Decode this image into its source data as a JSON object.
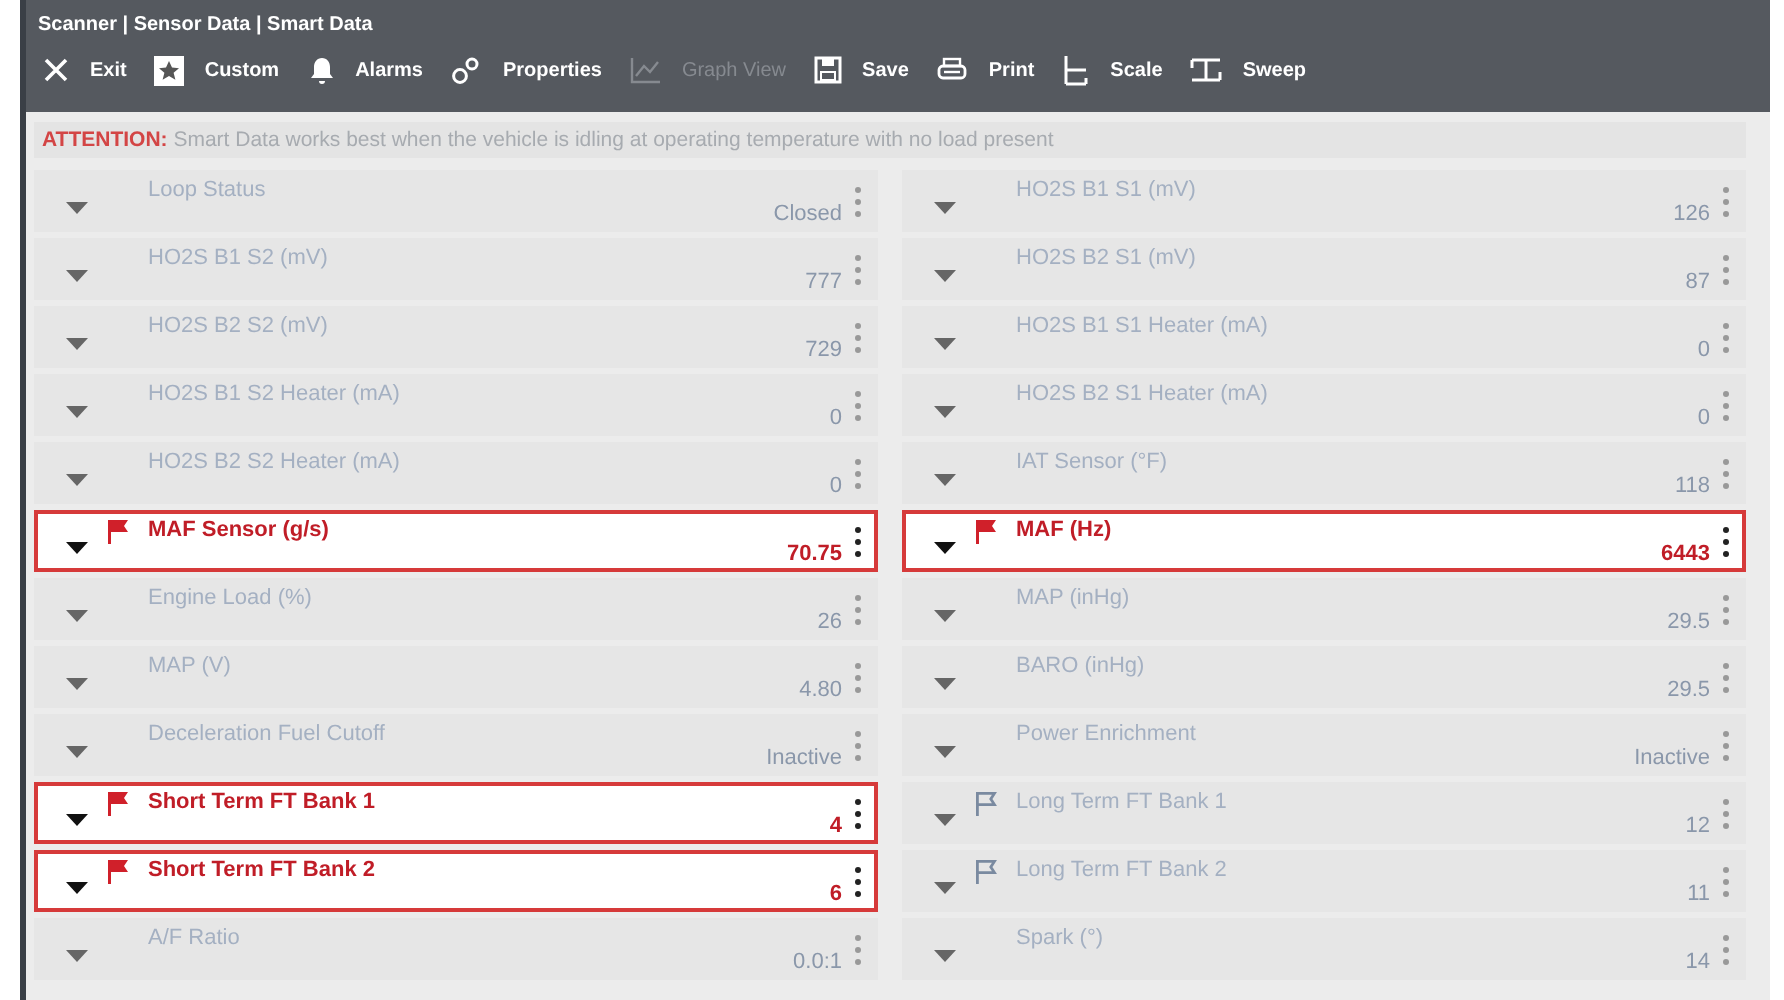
{
  "window": {
    "title": "Scanner | Sensor Data | Smart Data"
  },
  "toolbar": [
    {
      "kind": "exit",
      "label": "Exit",
      "disabled": false
    },
    {
      "kind": "custom",
      "label": "Custom",
      "disabled": false
    },
    {
      "kind": "alarms",
      "label": "Alarms",
      "disabled": false
    },
    {
      "kind": "properties",
      "label": "Properties",
      "disabled": false
    },
    {
      "kind": "graph",
      "label": "Graph View",
      "disabled": true
    },
    {
      "kind": "save",
      "label": "Save",
      "disabled": false
    },
    {
      "kind": "print",
      "label": "Print",
      "disabled": false
    },
    {
      "kind": "scale",
      "label": "Scale",
      "disabled": false
    },
    {
      "kind": "sweep",
      "label": "Sweep",
      "disabled": false
    }
  ],
  "attention": {
    "label": "ATTENTION:",
    "message": "Smart Data works best when the vehicle is idling at operating temperature with no load present"
  },
  "columns": [
    {
      "rows": [
        {
          "name": "Loop Status",
          "value": "Closed",
          "highlighted": false,
          "flagged": false
        },
        {
          "name": "HO2S B1 S2 (mV)",
          "value": "777",
          "highlighted": false,
          "flagged": false
        },
        {
          "name": "HO2S B2 S2 (mV)",
          "value": "729",
          "highlighted": false,
          "flagged": false
        },
        {
          "name": "HO2S B1 S2 Heater (mA)",
          "value": "0",
          "highlighted": false,
          "flagged": false
        },
        {
          "name": "HO2S B2 S2 Heater (mA)",
          "value": "0",
          "highlighted": false,
          "flagged": false
        },
        {
          "name": "MAF Sensor (g/s)",
          "value": "70.75",
          "highlighted": true,
          "flagged": true
        },
        {
          "name": "Engine Load (%)",
          "value": "26",
          "highlighted": false,
          "flagged": false
        },
        {
          "name": "MAP (V)",
          "value": "4.80",
          "highlighted": false,
          "flagged": false
        },
        {
          "name": "Deceleration Fuel Cutoff",
          "value": "Inactive",
          "highlighted": false,
          "flagged": false
        },
        {
          "name": "Short Term FT Bank 1",
          "value": "4",
          "highlighted": true,
          "flagged": true
        },
        {
          "name": "Short Term FT Bank 2",
          "value": "6",
          "highlighted": true,
          "flagged": true
        },
        {
          "name": "A/F Ratio",
          "value": "0.0:1",
          "highlighted": false,
          "flagged": false
        }
      ]
    },
    {
      "rows": [
        {
          "name": "HO2S B1 S1 (mV)",
          "value": "126",
          "highlighted": false,
          "flagged": false
        },
        {
          "name": "HO2S B2 S1 (mV)",
          "value": "87",
          "highlighted": false,
          "flagged": false
        },
        {
          "name": "HO2S B1 S1 Heater (mA)",
          "value": "0",
          "highlighted": false,
          "flagged": false
        },
        {
          "name": "HO2S B2 S1 Heater (mA)",
          "value": "0",
          "highlighted": false,
          "flagged": false
        },
        {
          "name": "IAT Sensor (°F)",
          "value": "118",
          "highlighted": false,
          "flagged": false
        },
        {
          "name": "MAF (Hz)",
          "value": "6443",
          "highlighted": true,
          "flagged": true
        },
        {
          "name": "MAP (inHg)",
          "value": "29.5",
          "highlighted": false,
          "flagged": false
        },
        {
          "name": "BARO (inHg)",
          "value": "29.5",
          "highlighted": false,
          "flagged": false
        },
        {
          "name": "Power Enrichment",
          "value": "Inactive",
          "highlighted": false,
          "flagged": false
        },
        {
          "name": "Long Term FT Bank 1",
          "value": "12",
          "highlighted": false,
          "flagged": true
        },
        {
          "name": "Long Term FT Bank 2",
          "value": "11",
          "highlighted": false,
          "flagged": true
        },
        {
          "name": "Spark (°)",
          "value": "14",
          "highlighted": false,
          "flagged": false
        }
      ]
    }
  ]
}
